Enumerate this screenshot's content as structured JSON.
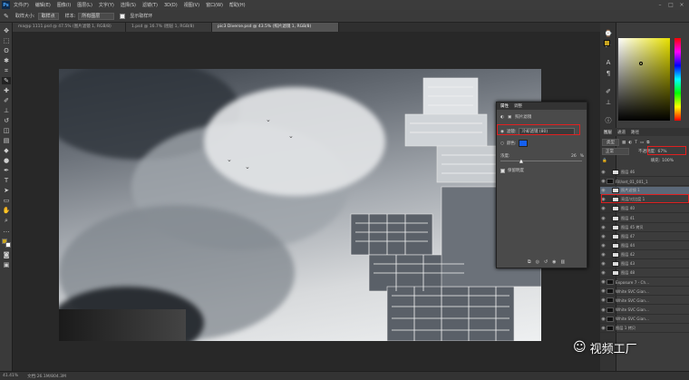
{
  "app": {
    "logo": "Ps"
  },
  "menu": [
    "文件(F)",
    "编辑(E)",
    "图像(I)",
    "图层(L)",
    "文字(Y)",
    "选择(S)",
    "滤镜(T)",
    "3D(D)",
    "视图(V)",
    "窗口(W)",
    "帮助(H)"
  ],
  "options": {
    "size_label": "取样大小:",
    "size_value": "取样点",
    "sample_label": "样本:",
    "sample_value": "所有图层",
    "ring_label": "显示取样环"
  },
  "tabs": [
    "ma@p 1111.psd @ 47.5% (图片滤镜 1, RGB/8)",
    "1.psd @ 16.7% (图层 1, RGB/8)",
    "pic3 Diverse.psd @ 43.5% (照片滤镜 1, RGB/8)"
  ],
  "status": {
    "zoom": "41.41%",
    "doc": "文档:26.1M/804.3M"
  },
  "properties": {
    "tabs": [
      "属性",
      "调整"
    ],
    "title": "照片滤镜",
    "filter_label": "滤镜:",
    "filter_value": "冷却滤镜 (80)",
    "color_label": "颜色:",
    "density_label": "浓度:",
    "density_value": "26",
    "density_unit": "%",
    "preserve_label": "保留明度",
    "filter_color": "#1560f0"
  },
  "layers_panel": {
    "tabs": [
      "图层",
      "通道",
      "路径"
    ],
    "kind_label": "类型",
    "blend_mode": "正常",
    "opacity_label": "不透明度:",
    "opacity_value": "67%",
    "fill_label": "填充:",
    "fill_value": "100%",
    "items": [
      "图层 46",
      "Fill/set_01_001_1",
      "照片滤镜 1",
      "亮度/对比度 1",
      "图层 40",
      "图层 41",
      "图层 45 拷贝",
      "图层 47",
      "图层 44",
      "图层 42",
      "图层 43",
      "图层 48",
      "Exposure 7 - Ch...",
      "White SVC Gian...",
      "White SVC Gian...",
      "White SVC Gian...",
      "White SVC Gian...",
      "图层 1 拷贝"
    ]
  },
  "watermark": "视频工厂"
}
